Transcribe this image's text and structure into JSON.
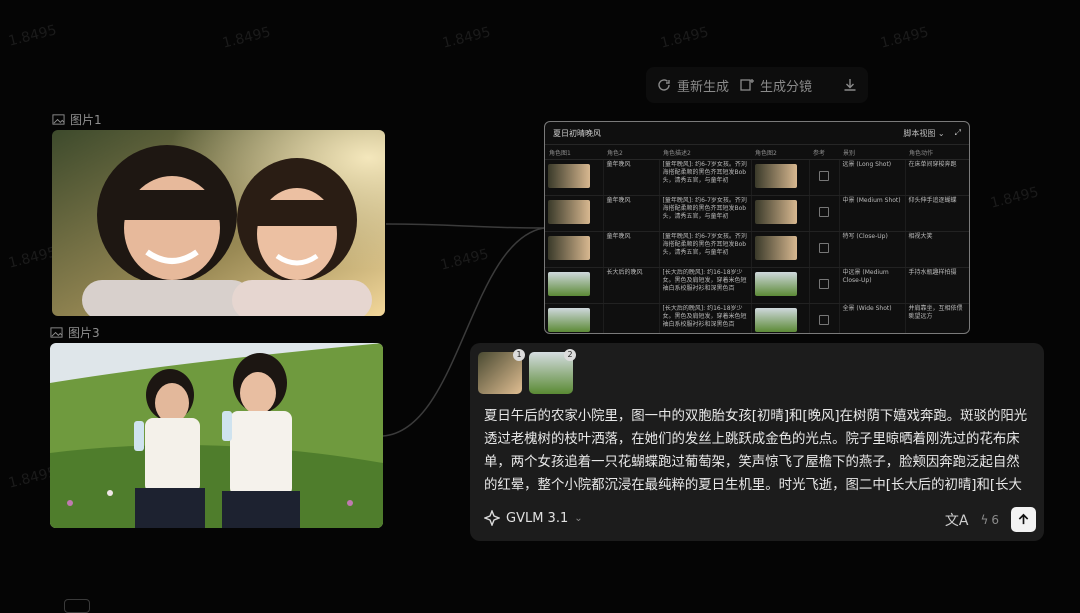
{
  "watermark": "1.8495",
  "toolbar": {
    "regenerate_label": "重新生成",
    "storyboard_label": "生成分镜",
    "download_icon": "download-icon"
  },
  "images": [
    {
      "label": "图片1",
      "icon": "image-icon"
    },
    {
      "label": "图片3",
      "icon": "image-icon"
    }
  ],
  "table_panel": {
    "title": "夏日初晴晚风",
    "view_label": "脚本视图",
    "columns": [
      "角色图1",
      "角色2",
      "角色描述2",
      "角色图2",
      "参考",
      "景别",
      "角色动作"
    ],
    "rows": [
      {
        "role2": "童年晚风",
        "desc": "[童年晚风]: 约6-7岁女孩。齐刘海搭配柔顺的黑色齐耳短发Bob头，清秀五官，与童年初",
        "ref": "图",
        "shot": "远景 (Long Shot)",
        "action": "在床单间穿梭奔跑"
      },
      {
        "role2": "童年晚风",
        "desc": "[童年晚风]: 约6-7岁女孩。齐刘海搭配柔顺的黑色齐耳短发Bob头，清秀五官，与童年初",
        "ref": "图",
        "shot": "中景 (Medium Shot)",
        "action": "仰头伸手追逐蝴蝶"
      },
      {
        "role2": "童年晚风",
        "desc": "[童年晚风]: 约6-7岁女孩。齐刘海搭配柔顺的黑色齐耳短发Bob头，清秀五官，与童年初",
        "ref": "图",
        "shot": "特写 (Close-Up)",
        "action": "相视大笑"
      },
      {
        "role2": "长大后的晚风",
        "desc": "[长大后的晚风]: 约16-18岁少女。黑色及肩短发，穿着米色短袖白系校服衬衫和深黑色百",
        "ref": "图",
        "shot": "中远景 (Medium Close-Up)",
        "action": "手持水瓶趣样拍摄"
      },
      {
        "role2": "",
        "desc": "[长大后的晚风]: 约16-18岁少女。黑色及肩短发，穿着米色短袖白系校服衬衫和深黑色百",
        "ref": "图",
        "shot": "全景 (Wide Shot)",
        "action": "并肩靠坐，互相依偎眺望远方"
      }
    ]
  },
  "prompt_card": {
    "chip_badges": [
      "1",
      "2"
    ],
    "prompt_text": "夏日午后的农家小院里，图一中的双胞胎女孩[初晴]和[晚风]在树荫下嬉戏奔跑。斑驳的阳光透过老槐树的枝叶洒落，在她们的发丝上跳跃成金色的光点。院子里晾晒着刚洗过的花布床单，两个女孩追着一只花蝴蝶跑过葡萄架，笑声惊飞了屋檐下的燕子，脸颊因奔跑泛起自然的红晕，整个小院都沉浸在最纯粹的夏日生机里。时光飞逝，图二中[长大后的初晴]和[长大后的晚风]感情依旧深厚，一",
    "model_name": "GVLM 3.1",
    "translate_glyph": "文A",
    "credits": "6"
  }
}
